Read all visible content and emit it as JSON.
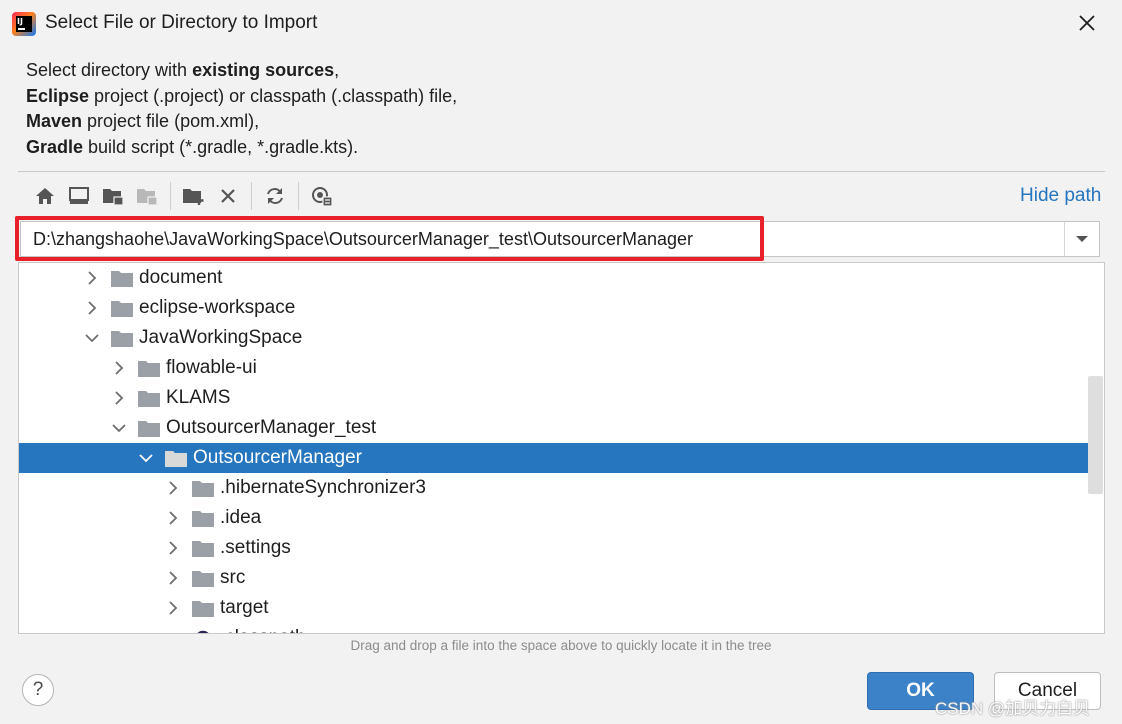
{
  "window": {
    "title": "Select File or Directory to Import",
    "app_logo_text": "IJ"
  },
  "description": [
    [
      {
        "t": "Select directory with ",
        "b": false
      },
      {
        "t": "existing sources",
        "b": true
      },
      {
        "t": ",",
        "b": false
      }
    ],
    [
      {
        "t": "Eclipse",
        "b": true
      },
      {
        "t": " project (.project) or classpath (.classpath) file,",
        "b": false
      }
    ],
    [
      {
        "t": "Maven",
        "b": true
      },
      {
        "t": " project file (pom.xml),",
        "b": false
      }
    ],
    [
      {
        "t": "Gradle",
        "b": true
      },
      {
        "t": " build script (*.gradle, *.gradle.kts).",
        "b": false
      }
    ]
  ],
  "toolbar": {
    "buttons": [
      "home-icon",
      "desktop-icon",
      "project-folder-icon",
      "module-folder-icon",
      "new-folder-icon",
      "delete-icon",
      "refresh-icon",
      "show-hidden-icon"
    ],
    "hide_path_label": "Hide path"
  },
  "path": {
    "value": "D:\\zhangshaohe\\JavaWorkingSpace\\OutsourcerManager_test\\OutsourcerManager"
  },
  "tree": [
    {
      "label": "document",
      "depth": 0,
      "expanded": false,
      "selected": false
    },
    {
      "label": "eclipse-workspace",
      "depth": 0,
      "expanded": false,
      "selected": false
    },
    {
      "label": "JavaWorkingSpace",
      "depth": 0,
      "expanded": true,
      "selected": false
    },
    {
      "label": "flowable-ui",
      "depth": 1,
      "expanded": false,
      "selected": false
    },
    {
      "label": "KLAMS",
      "depth": 1,
      "expanded": false,
      "selected": false
    },
    {
      "label": "OutsourcerManager_test",
      "depth": 1,
      "expanded": true,
      "selected": false
    },
    {
      "label": "OutsourcerManager",
      "depth": 2,
      "expanded": true,
      "selected": true
    },
    {
      "label": ".hibernateSynchronizer3",
      "depth": 3,
      "expanded": false,
      "selected": false
    },
    {
      "label": ".idea",
      "depth": 3,
      "expanded": false,
      "selected": false
    },
    {
      "label": ".settings",
      "depth": 3,
      "expanded": false,
      "selected": false
    },
    {
      "label": "src",
      "depth": 3,
      "expanded": false,
      "selected": false
    },
    {
      "label": "target",
      "depth": 3,
      "expanded": false,
      "selected": false
    },
    {
      "label": ".classpath",
      "depth": 3,
      "expanded": false,
      "selected": false,
      "file": true
    }
  ],
  "hint": "Drag and drop a file into the space above to quickly locate it in the tree",
  "buttons": {
    "help": "?",
    "ok": "OK",
    "cancel": "Cancel"
  },
  "watermark": "CSDN @加贝力白贝",
  "colors": {
    "selection": "#2675bf",
    "link": "#2675bf",
    "ok_button": "#3b82c8",
    "highlight_border": "#e8202a"
  }
}
